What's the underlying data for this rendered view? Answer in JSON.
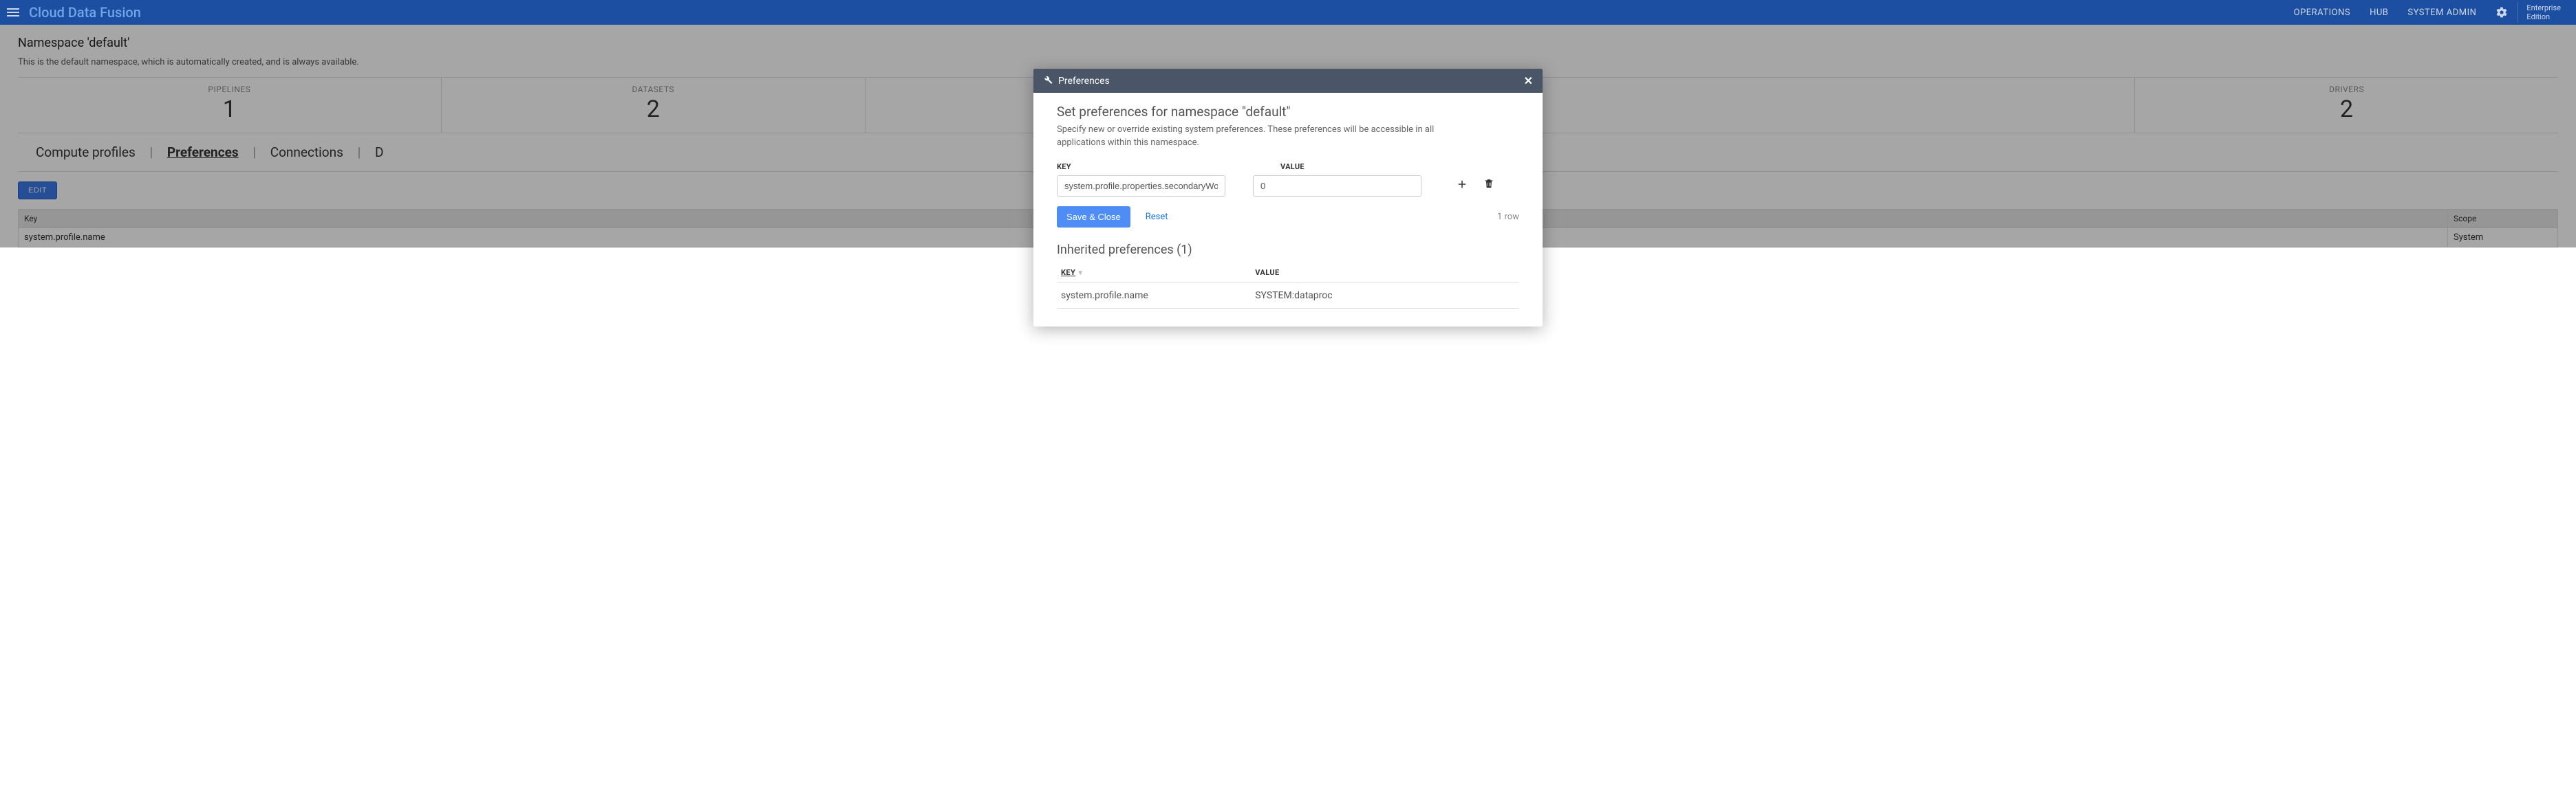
{
  "header": {
    "brand": "Cloud Data Fusion",
    "nav": {
      "operations": "OPERATIONS",
      "hub": "HUB",
      "system_admin": "SYSTEM ADMIN"
    },
    "edition": {
      "line1": "Enterprise",
      "line2": "Edition"
    }
  },
  "page": {
    "title": "Namespace 'default'",
    "description": "This is the default namespace, which is automatically created, and is always available.",
    "stats": {
      "pipelines": {
        "label": "PIPELINES",
        "value": "1"
      },
      "datasets": {
        "label": "DATASETS",
        "value": "2"
      },
      "drivers": {
        "label": "DRIVERS",
        "value": "2"
      }
    },
    "tabs": {
      "compute": "Compute profiles",
      "preferences": "Preferences",
      "connections": "Connections",
      "drivers_partial": "D"
    },
    "edit_label": "EDIT",
    "table": {
      "key_header": "Key",
      "scope_header": "Scope",
      "rows": [
        {
          "key": "system.profile.name",
          "scope": "System"
        }
      ]
    }
  },
  "modal": {
    "header_title": "Preferences",
    "title": "Set preferences for namespace \"default\"",
    "description": "Specify new or override existing system preferences. These preferences will be accessible in all applications within this namespace.",
    "key_label": "KEY",
    "value_label": "VALUE",
    "key_input": "system.profile.properties.secondaryWorkerNum",
    "value_input": "0",
    "save_label": "Save & Close",
    "reset_label": "Reset",
    "row_count": "1 row",
    "inherited_title": "Inherited preferences (1)",
    "inh_key_header": "KEY",
    "inh_value_header": "VALUE",
    "inh_rows": [
      {
        "key": "system.profile.name",
        "value": "SYSTEM:dataproc"
      }
    ]
  }
}
